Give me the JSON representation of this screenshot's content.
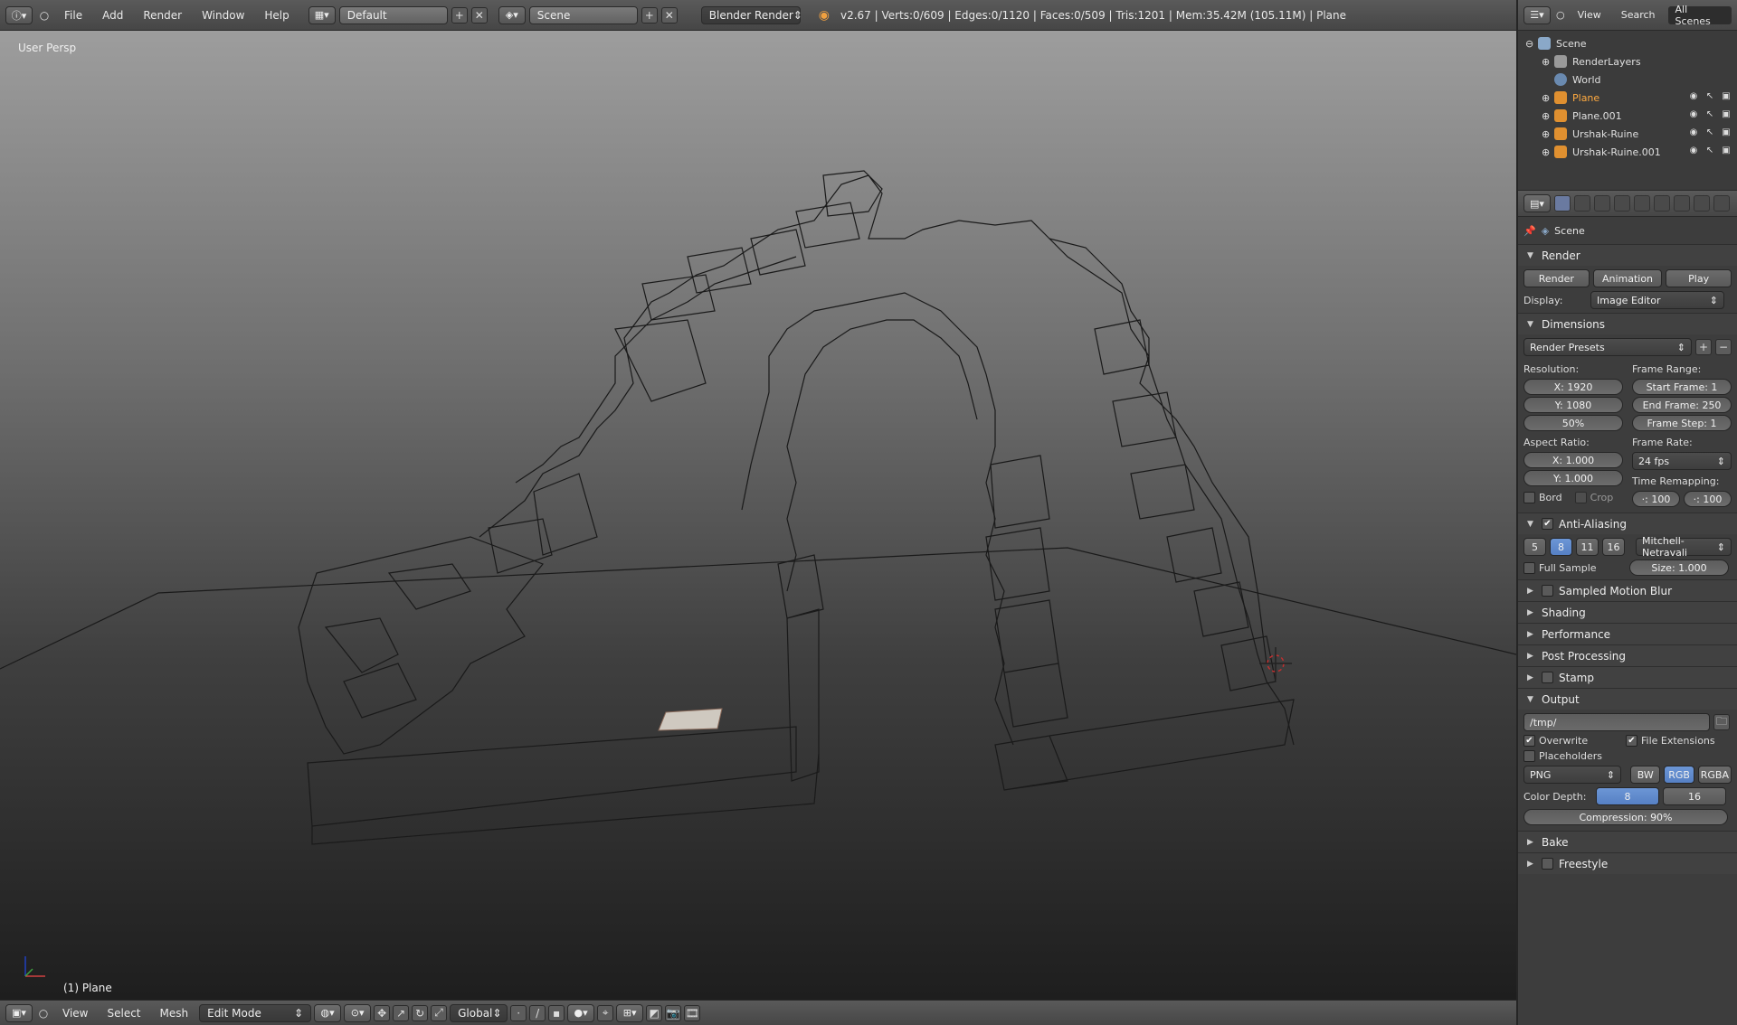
{
  "topbar": {
    "menus": [
      "File",
      "Add",
      "Render",
      "Window",
      "Help"
    ],
    "layout_name": "Default",
    "scene_name": "Scene",
    "engine": "Blender Render",
    "stats": "v2.67 | Verts:0/609 | Edges:0/1120 | Faces:0/509 | Tris:1201 | Mem:35.42M (105.11M) | Plane"
  },
  "viewport": {
    "perspective_label": "User Persp",
    "object_label": "(1) Plane"
  },
  "bottombar": {
    "menus": [
      "View",
      "Select",
      "Mesh"
    ],
    "mode": "Edit Mode",
    "orientation": "Global"
  },
  "outliner": {
    "tabs": [
      "View",
      "Search",
      "All Scenes"
    ],
    "items": [
      {
        "label": "Scene",
        "indent": 0
      },
      {
        "label": "RenderLayers",
        "indent": 1
      },
      {
        "label": "World",
        "indent": 1
      },
      {
        "label": "Plane",
        "indent": 1
      },
      {
        "label": "Plane.001",
        "indent": 1
      },
      {
        "label": "Urshak-Ruine",
        "indent": 1
      },
      {
        "label": "Urshak-Ruine.001",
        "indent": 1
      }
    ]
  },
  "props": {
    "scene": "Scene",
    "render": {
      "title": "Render",
      "render_btn": "Render",
      "animation_btn": "Animation",
      "play_btn": "Play",
      "display_label": "Display:",
      "display_value": "Image Editor"
    },
    "dimensions": {
      "title": "Dimensions",
      "presets": "Render Presets",
      "resolution_label": "Resolution:",
      "res_x": "X: 1920",
      "res_y": "Y: 1080",
      "res_pct": "50%",
      "frame_range_label": "Frame Range:",
      "start": "Start Frame: 1",
      "end": "End Frame: 250",
      "step": "Frame Step: 1",
      "aspect_label": "Aspect Ratio:",
      "asp_x": "X: 1.000",
      "asp_y": "Y: 1.000",
      "frame_rate_label": "Frame Rate:",
      "frame_rate": "24 fps",
      "time_remap_label": "Time Remapping:",
      "remap_old": "·: 100",
      "remap_new": "·: 100",
      "bord": "Bord",
      "crop": "Crop"
    },
    "aa": {
      "title": "Anti-Aliasing",
      "samples": [
        "5",
        "8",
        "11",
        "16"
      ],
      "filter": "Mitchell-Netravali",
      "full_sample": "Full Sample",
      "size": "Size: 1.000"
    },
    "collapsed": [
      {
        "title": "Sampled Motion Blur",
        "check": true
      },
      {
        "title": "Shading",
        "check": false
      },
      {
        "title": "Performance",
        "check": false
      },
      {
        "title": "Post Processing",
        "check": false
      },
      {
        "title": "Stamp",
        "check": true
      }
    ],
    "output": {
      "title": "Output",
      "path": "/tmp/",
      "overwrite": "Overwrite",
      "file_ext": "File Extensions",
      "placeholders": "Placeholders",
      "format": "PNG",
      "bw": "BW",
      "rgb": "RGB",
      "rgba": "RGBA",
      "depth_label": "Color Depth:",
      "depth_8": "8",
      "depth_16": "16",
      "compression": "Compression: 90%"
    },
    "bake": "Bake",
    "freestyle": "Freestyle"
  }
}
